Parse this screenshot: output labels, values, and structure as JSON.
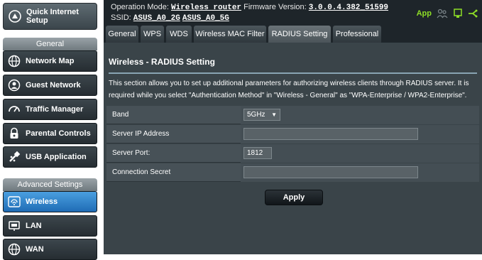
{
  "sidebar": {
    "quick_setup": {
      "line1": "Quick Internet",
      "line2": "Setup",
      "icon": "quick-setup-icon"
    },
    "general_header": "General",
    "general_items": [
      {
        "label": "Network Map",
        "icon": "globe-icon"
      },
      {
        "label": "Guest Network",
        "icon": "guest-network-icon"
      },
      {
        "label": "Traffic Manager",
        "icon": "gauge-icon"
      },
      {
        "label": "Parental Controls",
        "icon": "lock-icon"
      },
      {
        "label": "USB Application",
        "icon": "usb-icon"
      }
    ],
    "advanced_header": "Advanced Settings",
    "advanced_items": [
      {
        "label": "Wireless",
        "icon": "wifi-icon",
        "active": true
      },
      {
        "label": "LAN",
        "icon": "lan-icon"
      },
      {
        "label": "WAN",
        "icon": "wan-icon"
      }
    ]
  },
  "topbar": {
    "op_mode_label": "Operation Mode:",
    "op_mode_value": "Wireless router",
    "firmware_label": "Firmware Version:",
    "firmware_value": "3.0.0.4.382_51599",
    "ssid_label": "SSID:",
    "ssid_2g": "ASUS_A0_2G",
    "ssid_5g": "ASUS_A0_5G",
    "app_label": "App",
    "accent": "#8ede26"
  },
  "tabs": [
    "General",
    "WPS",
    "WDS",
    "Wireless MAC Filter",
    "RADIUS Setting",
    "Professional"
  ],
  "page": {
    "title": "Wireless - RADIUS Setting",
    "description": "This section allows you to set up additional parameters for authorizing wireless clients through RADIUS server. It is required while you select \"Authentication Method\" in \"Wireless - General\" as \"WPA-Enterprise / WPA2-Enterprise\".",
    "band_label": "Band",
    "band_value": "5GHz",
    "server_ip_label": "Server IP Address",
    "server_ip_value": "",
    "server_port_label": "Server Port:",
    "server_port_value": "1812",
    "secret_label": "Connection Secret",
    "secret_value": "",
    "apply_label": "Apply"
  }
}
